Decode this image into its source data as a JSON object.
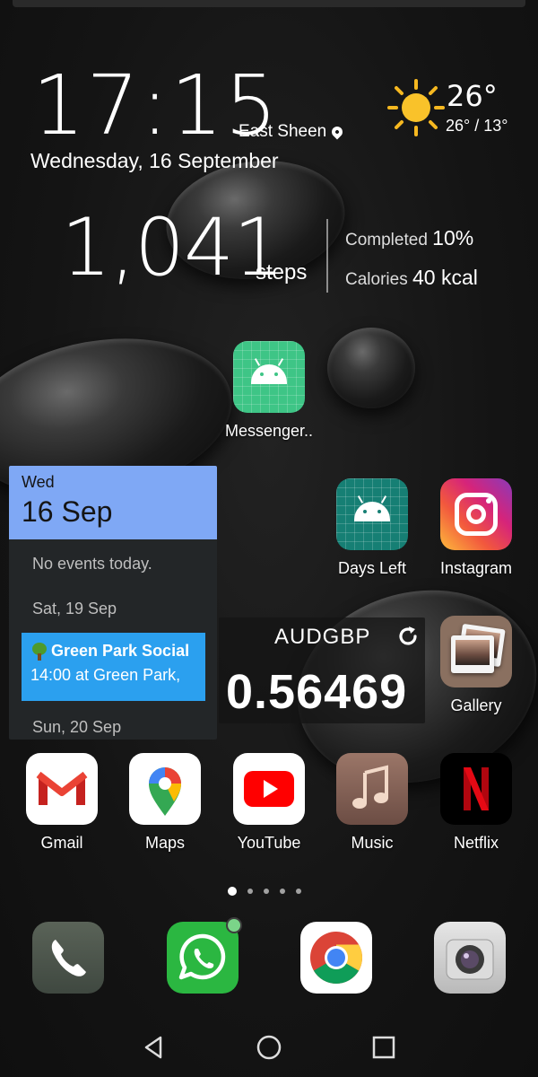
{
  "clock": {
    "time": "17:15",
    "location": "East Sheen",
    "date": "Wednesday, 16 September"
  },
  "weather": {
    "temp": "26°",
    "range": "26° / 13°",
    "icon": "sun-icon"
  },
  "health": {
    "steps": "1,041",
    "steps_label": "steps",
    "completed_label": "Completed",
    "completed_value": "10%",
    "calories_label": "Calories",
    "calories_value": "40 kcal"
  },
  "apps": {
    "messenger": "Messenger..",
    "days_left": "Days Left",
    "instagram": "Instagram",
    "gallery": "Gallery",
    "gmail": "Gmail",
    "maps": "Maps",
    "youtube": "YouTube",
    "music": "Music",
    "netflix": "Netflix"
  },
  "calendar": {
    "day": "Wed",
    "date": "16 Sep",
    "no_events": "No events today.",
    "next_day": "Sat, 19 Sep",
    "event_title": "Green Park Social",
    "event_detail": "14:00 at Green Park,",
    "following_day": "Sun, 20 Sep"
  },
  "currency": {
    "pair": "AUDGBP",
    "value": "0.56469"
  },
  "pager": {
    "pages": 5,
    "active_page": 1
  },
  "dock": [
    "phone-icon",
    "whatsapp-icon",
    "chrome-icon",
    "camera-icon"
  ],
  "colors": {
    "calendar_header": "#7fa8f5",
    "event_bg": "#2ba0ef",
    "whatsapp_badge": "#7bd489"
  }
}
